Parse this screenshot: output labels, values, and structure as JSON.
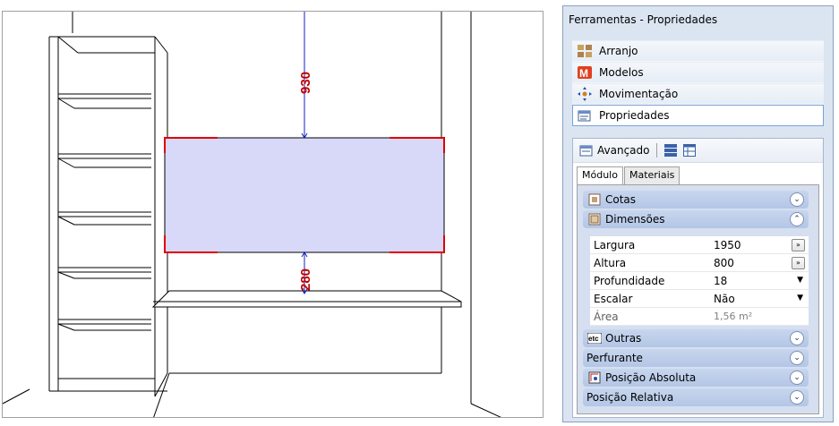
{
  "viewport": {
    "dim_top": "930",
    "dim_bottom": "280"
  },
  "panel": {
    "title": "Ferramentas - Propriedades",
    "tools": [
      {
        "label": "Arranjo",
        "icon": "arrange-icon"
      },
      {
        "label": "Modelos",
        "icon": "models-icon"
      },
      {
        "label": "Movimentação",
        "icon": "move-icon"
      },
      {
        "label": "Propriedades",
        "icon": "properties-icon"
      }
    ],
    "advanced": {
      "label": "Avançado",
      "tabs": [
        "Módulo",
        "Materiais"
      ],
      "sections": {
        "cotas": "Cotas",
        "dimensoes": "Dimensões",
        "outras": "Outras",
        "perfurante": "Perfurante",
        "posicao_absoluta": "Posição Absoluta",
        "posicao_relativa": "Posição Relativa"
      },
      "properties": [
        {
          "name": "Largura",
          "value": "1950"
        },
        {
          "name": "Altura",
          "value": "800"
        },
        {
          "name": "Profundidade",
          "value": "18"
        },
        {
          "name": "Escalar",
          "value": "Não"
        },
        {
          "name": "Área",
          "value": "1,56 m²"
        }
      ]
    }
  },
  "colors": {
    "panel_bg": "#dbe5f2",
    "selection_fill": "#d8d8f8",
    "selection_handles": "#e00000",
    "dimension_line": "#1020c0",
    "dimension_text": "#c00000"
  }
}
